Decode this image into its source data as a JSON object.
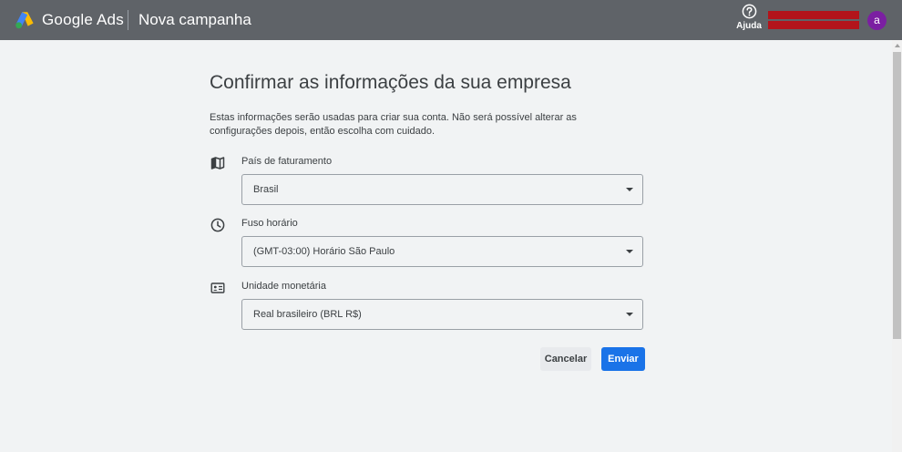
{
  "header": {
    "product_name": "Google Ads",
    "campaign_title": "Nova campanha",
    "help_label": "Ajuda",
    "avatar_initial": "a"
  },
  "main": {
    "title": "Confirmar as informações da sua empresa",
    "description": "Estas informações serão usadas para criar sua conta. Não será possível alterar as configurações depois, então escolha com cuidado.",
    "fields": [
      {
        "icon": "map-icon",
        "label": "País de faturamento",
        "value": "Brasil"
      },
      {
        "icon": "clock-icon",
        "label": "Fuso horário",
        "value": "(GMT-03:00) Horário São Paulo"
      },
      {
        "icon": "currency-card-icon",
        "label": "Unidade monetária",
        "value": "Real brasileiro (BRL R$)"
      }
    ],
    "cancel_label": "Cancelar",
    "submit_label": "Enviar"
  },
  "colors": {
    "header_bg": "#5f6368",
    "page_bg": "#f1f3f4",
    "primary": "#1a73e8",
    "avatar": "#7b1fa2",
    "redaction": "#b3141b"
  }
}
